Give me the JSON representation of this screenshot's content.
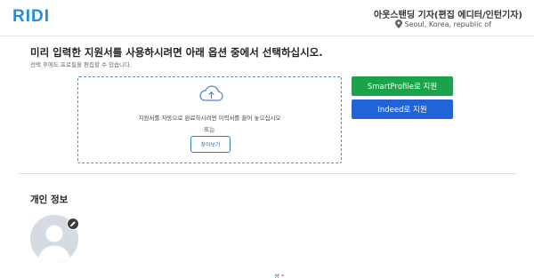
{
  "header": {
    "logo": "RIDI",
    "job_title": "아웃스탠딩 기자(편집 에디터/인턴기자)",
    "location": "Seoul, Korea, republic of",
    "location_icon": "map-pin-icon"
  },
  "apply": {
    "headline": "미리 입력한 지원서를 사용하시려면 아래 옵션 중에서 선택하십시오.",
    "subline": "선택 후에도 프로필을 편집할 수 있습니다.",
    "dropzone_text": "지원서를 자동으로 완료하시려면 이력서를 끌어 놓으십시오",
    "or_text": "또는",
    "browse_label": "찾아보기",
    "upload_icon": "cloud-upload-icon",
    "smartprofile_label": "SmartProfile로 지원",
    "indeed_label": "Indeed로 지원",
    "colors": {
      "smartprofile": "#1aa34a",
      "indeed": "#2064d8",
      "brand": "#1f8ce6"
    }
  },
  "personal": {
    "section_title": "개인 정보",
    "avatar_icon": "avatar-placeholder-icon",
    "edit_icon": "pencil-icon",
    "last_name_label": "성",
    "required_mark": "*"
  }
}
